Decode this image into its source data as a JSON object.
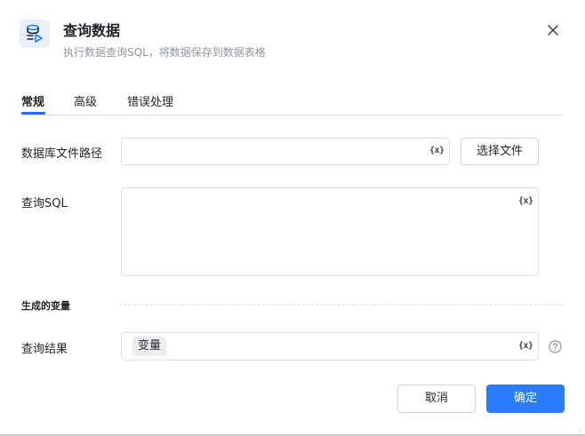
{
  "dialog": {
    "title": "查询数据",
    "subtitle": "执行数据查询SQL，将数据保存到数据表格",
    "icon": "database-query-icon"
  },
  "tabs": [
    {
      "label": "常规",
      "active": true
    },
    {
      "label": "高级",
      "active": false
    },
    {
      "label": "错误处理",
      "active": false
    }
  ],
  "fields": {
    "db_path": {
      "label": "数据库文件路径",
      "value": "",
      "var_button": "{x}"
    },
    "select_file_label": "选择文件",
    "sql": {
      "label": "查询SQL",
      "value": "",
      "var_button": "{x}"
    }
  },
  "output": {
    "section_title": "生成的变量",
    "result": {
      "label": "查询结果",
      "tag": "变量",
      "var_button": "{x}"
    }
  },
  "footer": {
    "cancel_label": "取消",
    "ok_label": "确定"
  },
  "colors": {
    "primary": "#2b7cff",
    "border": "#dee0e3",
    "text": "#1f2329",
    "muted": "#8f959e"
  }
}
